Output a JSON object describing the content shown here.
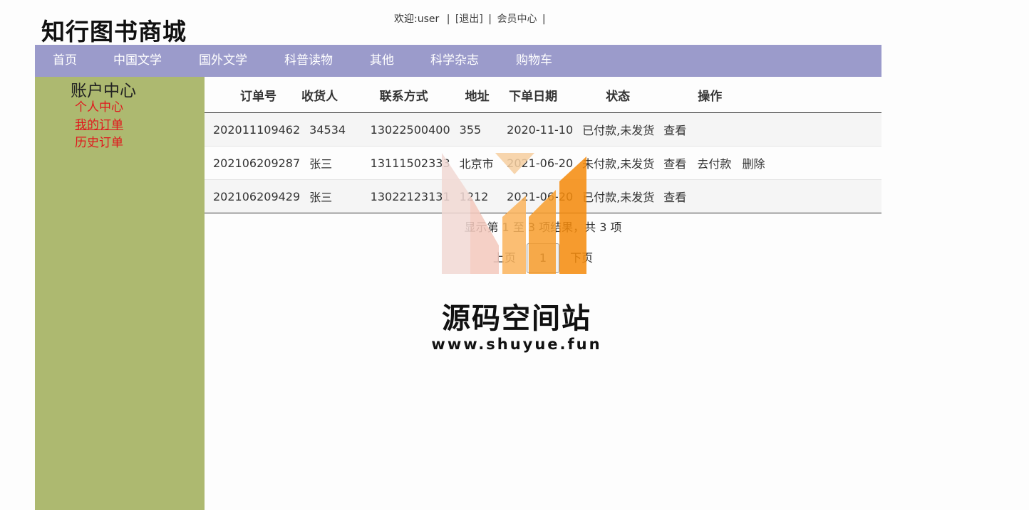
{
  "site": {
    "logo": "知行图书商城"
  },
  "topbar": {
    "welcome": "欢迎:user",
    "logout": "[退出]",
    "member_center": "会员中心",
    "sep": "|"
  },
  "nav": {
    "items": [
      "首页",
      "中国文学",
      "国外文学",
      "科普读物",
      "其他",
      "科学杂志",
      "购物车"
    ]
  },
  "sidebar": {
    "title": "账户中心",
    "links": [
      "个人中心",
      "我的订单",
      "历史订单"
    ]
  },
  "table": {
    "headers": [
      "订单号",
      "收货人",
      "联系方式",
      "地址",
      "下单日期",
      "状态",
      "操作"
    ],
    "rows": [
      {
        "id": "202011109462",
        "receiver": "34534",
        "contact": "13022500400",
        "address": "355",
        "date": "2020-11-10",
        "status": "已付款,未发货",
        "actions": [
          "查看"
        ]
      },
      {
        "id": "202106209287",
        "receiver": "张三",
        "contact": "13111502333",
        "address": "北京市",
        "date": "2021-06-20",
        "status": "未付款,未发货",
        "actions": [
          "查看",
          "去付款",
          "删除"
        ]
      },
      {
        "id": "202106209429",
        "receiver": "张三",
        "contact": "13022123131",
        "address": "1212",
        "date": "2021-06-20",
        "status": "已付款,未发货",
        "actions": [
          "查看"
        ]
      }
    ]
  },
  "pager": {
    "info": "显示第 1 至 3 项结果，共 3 项",
    "prev": "上页",
    "current": "1",
    "next": "下页"
  },
  "watermark": {
    "title": "源码空间站",
    "url": "www.shuyue.fun"
  }
}
